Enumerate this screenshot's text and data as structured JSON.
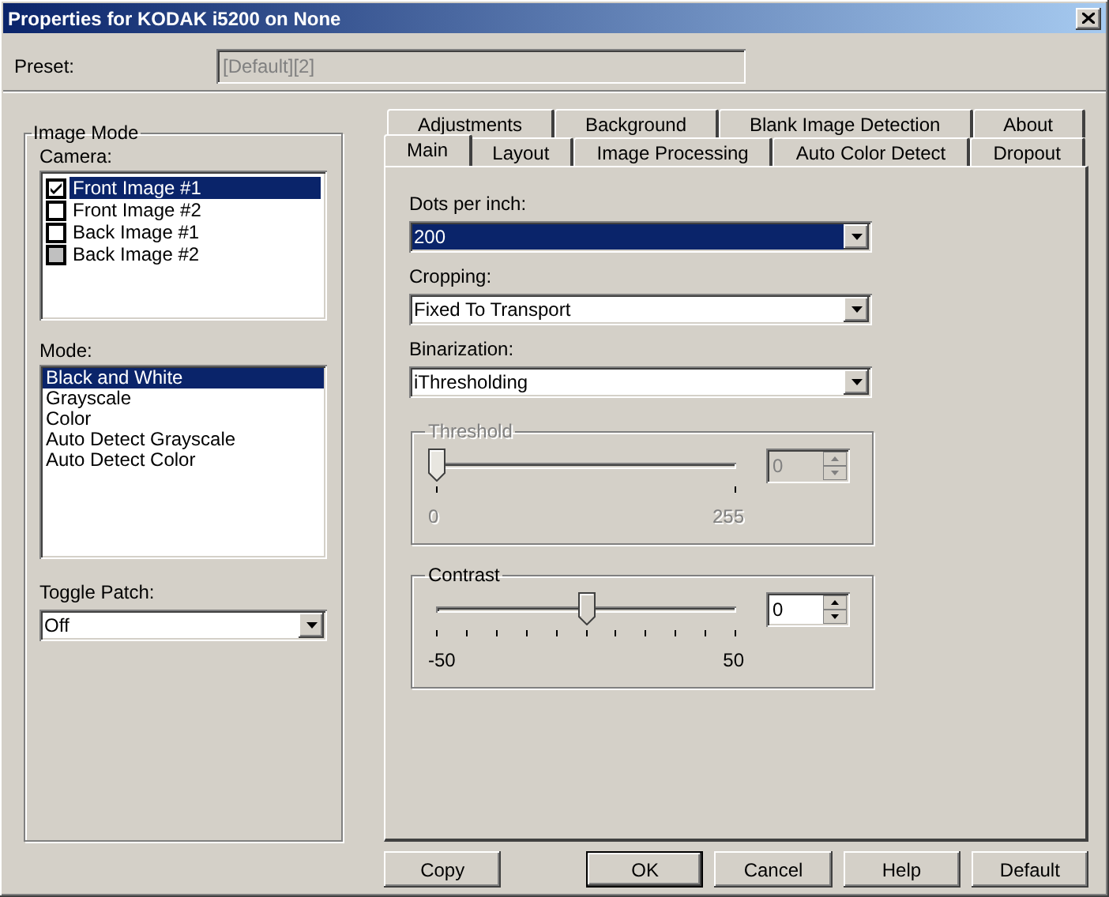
{
  "window": {
    "title": "Properties for KODAK i5200 on None"
  },
  "preset": {
    "label": "Preset:",
    "value": "[Default][2]",
    "disabled": true
  },
  "image_mode": {
    "title": "Image Mode",
    "camera": {
      "label": "Camera:",
      "items": [
        {
          "label": "Front Image #1",
          "checked": true,
          "disabled": false,
          "selected": true
        },
        {
          "label": "Front Image #2",
          "checked": false,
          "disabled": false,
          "selected": false
        },
        {
          "label": "Back Image #1",
          "checked": false,
          "disabled": false,
          "selected": false
        },
        {
          "label": "Back Image #2",
          "checked": false,
          "disabled": true,
          "selected": false
        }
      ]
    },
    "mode": {
      "label": "Mode:",
      "items": [
        {
          "label": "Black and White",
          "selected": true
        },
        {
          "label": "Grayscale",
          "selected": false
        },
        {
          "label": "Color",
          "selected": false
        },
        {
          "label": "Auto Detect Grayscale",
          "selected": false
        },
        {
          "label": "Auto Detect Color",
          "selected": false
        }
      ]
    },
    "toggle_patch": {
      "label": "Toggle Patch:",
      "value": "Off"
    }
  },
  "tab_rows": [
    {
      "tabs": [
        {
          "label": "Adjustments",
          "selected": false
        },
        {
          "label": "Background",
          "selected": false
        },
        {
          "label": "Blank Image Detection",
          "selected": false
        },
        {
          "label": "About",
          "selected": false
        }
      ]
    },
    {
      "tabs": [
        {
          "label": "Main",
          "selected": true
        },
        {
          "label": "Layout",
          "selected": false
        },
        {
          "label": "Image Processing",
          "selected": false
        },
        {
          "label": "Auto Color Detect",
          "selected": false
        },
        {
          "label": "Dropout",
          "selected": false
        }
      ]
    }
  ],
  "main": {
    "dropdowns": [
      {
        "label": "Dots per inch:",
        "value": "200",
        "focused": true
      },
      {
        "label": "Cropping:",
        "value": "Fixed To Transport",
        "focused": false
      },
      {
        "label": "Binarization:",
        "value": "iThresholding",
        "focused": false
      }
    ],
    "sliders": [
      {
        "title": "Threshold",
        "disabled": true,
        "level": 0,
        "value": "0",
        "min_label": "0",
        "max_label": "255",
        "kind": "ends"
      },
      {
        "title": "Contrast",
        "disabled": false,
        "level": 0.5,
        "value": "0",
        "min_label": "-50",
        "max_label": "50",
        "kind": "full"
      }
    ]
  },
  "buttons": [
    {
      "label": "Copy",
      "default": false
    },
    {
      "label": "OK",
      "default": true
    },
    {
      "label": "Cancel",
      "default": false
    },
    {
      "label": "Help",
      "default": false
    },
    {
      "label": "Default",
      "default": false
    }
  ]
}
